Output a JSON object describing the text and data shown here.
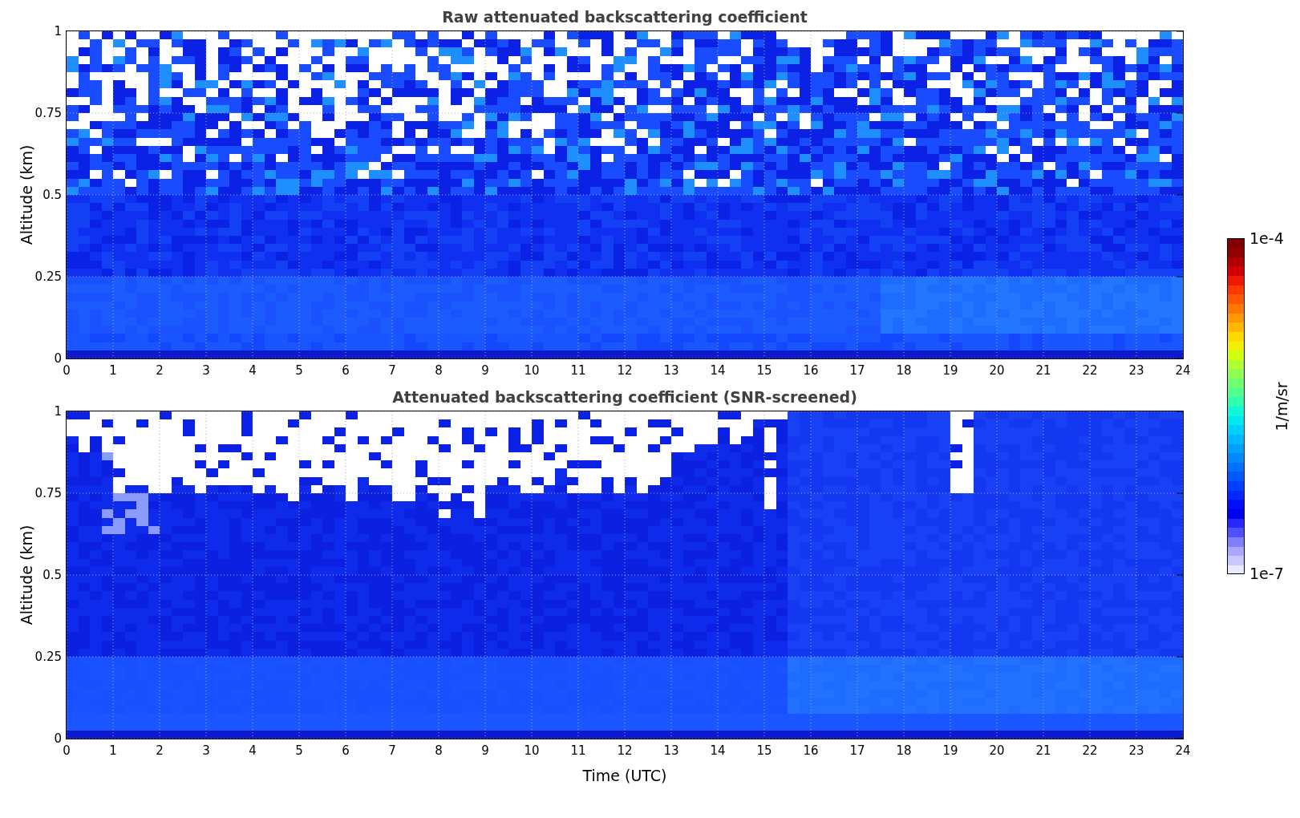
{
  "panels": [
    {
      "kind": "raw",
      "title": "Raw attenuated backscattering coefficient",
      "ylabel": "Altitude (km)",
      "yticks": [
        "1",
        "0.75",
        "0.5",
        "0.25",
        "0"
      ],
      "xticks": [
        "0",
        "1",
        "2",
        "3",
        "4",
        "5",
        "6",
        "7",
        "8",
        "9",
        "10",
        "11",
        "12",
        "13",
        "14",
        "15",
        "16",
        "17",
        "18",
        "19",
        "20",
        "21",
        "22",
        "23",
        "24"
      ]
    },
    {
      "kind": "screened",
      "title": "Attenuated backscattering coefficient (SNR-screened)",
      "ylabel": "Altitude (km)",
      "yticks": [
        "1",
        "0.75",
        "0.5",
        "0.25",
        "0"
      ],
      "xticks": [
        "0",
        "1",
        "2",
        "3",
        "4",
        "5",
        "6",
        "7",
        "8",
        "9",
        "10",
        "11",
        "12",
        "13",
        "14",
        "15",
        "16",
        "17",
        "18",
        "19",
        "20",
        "21",
        "22",
        "23",
        "24"
      ]
    }
  ],
  "xlabel": "Time (UTC)",
  "colorbar": {
    "max_label": "1e-4",
    "min_label": "1e-7",
    "unit": "1/m/sr"
  }
}
